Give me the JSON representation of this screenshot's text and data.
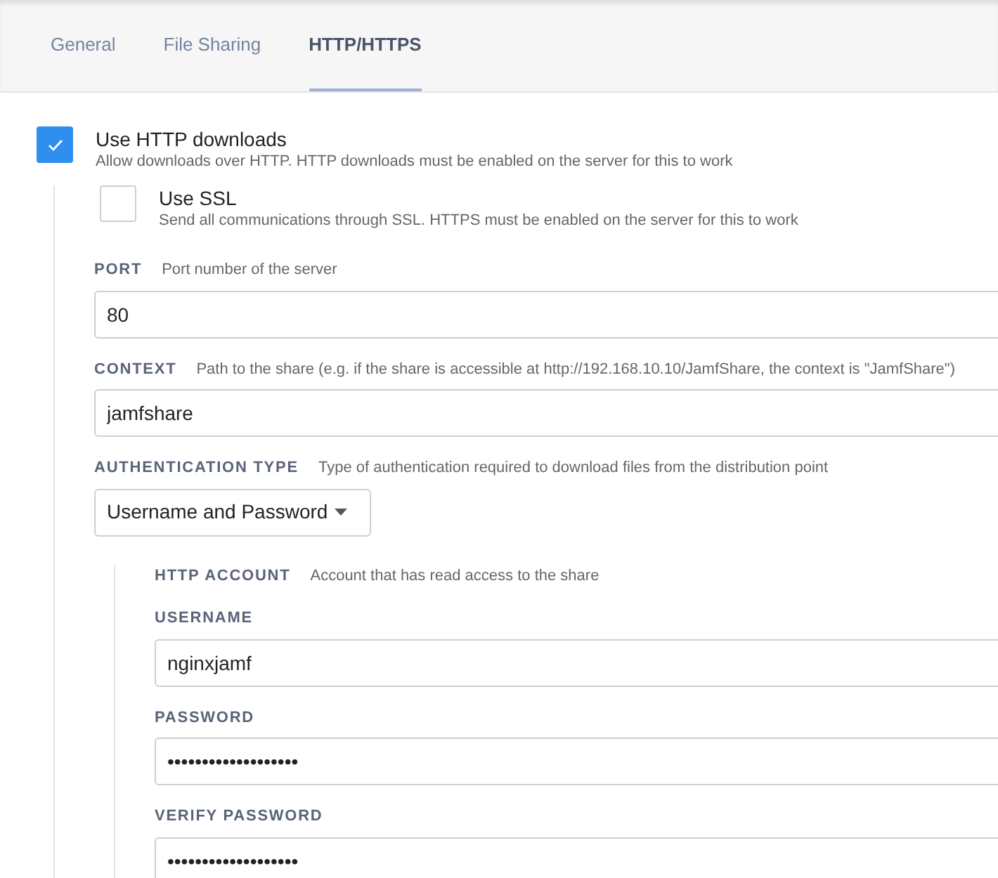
{
  "tabs": [
    {
      "label": "General",
      "selected": false
    },
    {
      "label": "File Sharing",
      "selected": false
    },
    {
      "label": "HTTP/HTTPS",
      "selected": true
    }
  ],
  "http_downloads": {
    "label": "Use HTTP downloads",
    "description": "Allow downloads over HTTP. HTTP downloads must be enabled on the server for this to work",
    "checked": true
  },
  "use_ssl": {
    "label": "Use SSL",
    "description": "Send all communications through SSL. HTTPS must be enabled on the server for this to work",
    "checked": false
  },
  "port": {
    "label": "PORT",
    "hint": "Port number of the server",
    "value": "80"
  },
  "context": {
    "label": "CONTEXT",
    "hint": "Path to the share (e.g. if the share is accessible at http://192.168.10.10/JamfShare, the context is \"JamfShare\")",
    "value": "jamfshare"
  },
  "authentication_type": {
    "label": "AUTHENTICATION TYPE",
    "hint": "Type of authentication required to download files from the distribution point",
    "value": "Username and Password"
  },
  "http_account": {
    "label": "HTTP ACCOUNT",
    "hint": "Account that has read access to the share",
    "fields": [
      {
        "label": "USERNAME",
        "value": "nginxjamf"
      },
      {
        "label": "PASSWORD",
        "value": "•••••••••••••••••••"
      },
      {
        "label": "VERIFY PASSWORD",
        "value": "•••••••••••••••••••"
      }
    ]
  }
}
